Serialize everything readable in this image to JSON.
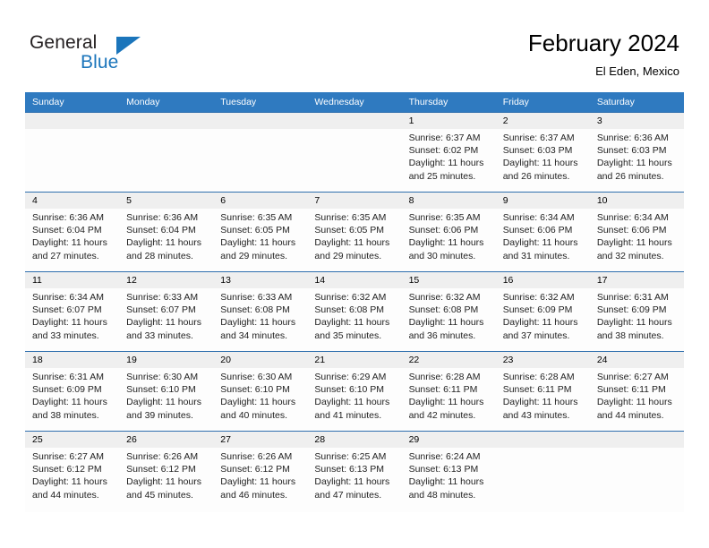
{
  "brand": {
    "name_part1": "General",
    "name_part2": "Blue",
    "logo_icon": "triangle-flag-icon",
    "accent_color": "#1b75bb"
  },
  "header": {
    "title": "February 2024",
    "subtitle": "El Eden, Mexico"
  },
  "colors": {
    "header_row_bg": "#2f7ac0",
    "date_band_bg": "#efefef",
    "row_divider": "#2f6fae"
  },
  "weekday_headers": [
    "Sunday",
    "Monday",
    "Tuesday",
    "Wednesday",
    "Thursday",
    "Friday",
    "Saturday"
  ],
  "weeks": [
    [
      {
        "day": "",
        "sunrise": "",
        "sunset": "",
        "daylight_line1": "",
        "daylight_line2": ""
      },
      {
        "day": "",
        "sunrise": "",
        "sunset": "",
        "daylight_line1": "",
        "daylight_line2": ""
      },
      {
        "day": "",
        "sunrise": "",
        "sunset": "",
        "daylight_line1": "",
        "daylight_line2": ""
      },
      {
        "day": "",
        "sunrise": "",
        "sunset": "",
        "daylight_line1": "",
        "daylight_line2": ""
      },
      {
        "day": "1",
        "sunrise": "Sunrise: 6:37 AM",
        "sunset": "Sunset: 6:02 PM",
        "daylight_line1": "Daylight: 11 hours",
        "daylight_line2": "and 25 minutes."
      },
      {
        "day": "2",
        "sunrise": "Sunrise: 6:37 AM",
        "sunset": "Sunset: 6:03 PM",
        "daylight_line1": "Daylight: 11 hours",
        "daylight_line2": "and 26 minutes."
      },
      {
        "day": "3",
        "sunrise": "Sunrise: 6:36 AM",
        "sunset": "Sunset: 6:03 PM",
        "daylight_line1": "Daylight: 11 hours",
        "daylight_line2": "and 26 minutes."
      }
    ],
    [
      {
        "day": "4",
        "sunrise": "Sunrise: 6:36 AM",
        "sunset": "Sunset: 6:04 PM",
        "daylight_line1": "Daylight: 11 hours",
        "daylight_line2": "and 27 minutes."
      },
      {
        "day": "5",
        "sunrise": "Sunrise: 6:36 AM",
        "sunset": "Sunset: 6:04 PM",
        "daylight_line1": "Daylight: 11 hours",
        "daylight_line2": "and 28 minutes."
      },
      {
        "day": "6",
        "sunrise": "Sunrise: 6:35 AM",
        "sunset": "Sunset: 6:05 PM",
        "daylight_line1": "Daylight: 11 hours",
        "daylight_line2": "and 29 minutes."
      },
      {
        "day": "7",
        "sunrise": "Sunrise: 6:35 AM",
        "sunset": "Sunset: 6:05 PM",
        "daylight_line1": "Daylight: 11 hours",
        "daylight_line2": "and 29 minutes."
      },
      {
        "day": "8",
        "sunrise": "Sunrise: 6:35 AM",
        "sunset": "Sunset: 6:06 PM",
        "daylight_line1": "Daylight: 11 hours",
        "daylight_line2": "and 30 minutes."
      },
      {
        "day": "9",
        "sunrise": "Sunrise: 6:34 AM",
        "sunset": "Sunset: 6:06 PM",
        "daylight_line1": "Daylight: 11 hours",
        "daylight_line2": "and 31 minutes."
      },
      {
        "day": "10",
        "sunrise": "Sunrise: 6:34 AM",
        "sunset": "Sunset: 6:06 PM",
        "daylight_line1": "Daylight: 11 hours",
        "daylight_line2": "and 32 minutes."
      }
    ],
    [
      {
        "day": "11",
        "sunrise": "Sunrise: 6:34 AM",
        "sunset": "Sunset: 6:07 PM",
        "daylight_line1": "Daylight: 11 hours",
        "daylight_line2": "and 33 minutes."
      },
      {
        "day": "12",
        "sunrise": "Sunrise: 6:33 AM",
        "sunset": "Sunset: 6:07 PM",
        "daylight_line1": "Daylight: 11 hours",
        "daylight_line2": "and 33 minutes."
      },
      {
        "day": "13",
        "sunrise": "Sunrise: 6:33 AM",
        "sunset": "Sunset: 6:08 PM",
        "daylight_line1": "Daylight: 11 hours",
        "daylight_line2": "and 34 minutes."
      },
      {
        "day": "14",
        "sunrise": "Sunrise: 6:32 AM",
        "sunset": "Sunset: 6:08 PM",
        "daylight_line1": "Daylight: 11 hours",
        "daylight_line2": "and 35 minutes."
      },
      {
        "day": "15",
        "sunrise": "Sunrise: 6:32 AM",
        "sunset": "Sunset: 6:08 PM",
        "daylight_line1": "Daylight: 11 hours",
        "daylight_line2": "and 36 minutes."
      },
      {
        "day": "16",
        "sunrise": "Sunrise: 6:32 AM",
        "sunset": "Sunset: 6:09 PM",
        "daylight_line1": "Daylight: 11 hours",
        "daylight_line2": "and 37 minutes."
      },
      {
        "day": "17",
        "sunrise": "Sunrise: 6:31 AM",
        "sunset": "Sunset: 6:09 PM",
        "daylight_line1": "Daylight: 11 hours",
        "daylight_line2": "and 38 minutes."
      }
    ],
    [
      {
        "day": "18",
        "sunrise": "Sunrise: 6:31 AM",
        "sunset": "Sunset: 6:09 PM",
        "daylight_line1": "Daylight: 11 hours",
        "daylight_line2": "and 38 minutes."
      },
      {
        "day": "19",
        "sunrise": "Sunrise: 6:30 AM",
        "sunset": "Sunset: 6:10 PM",
        "daylight_line1": "Daylight: 11 hours",
        "daylight_line2": "and 39 minutes."
      },
      {
        "day": "20",
        "sunrise": "Sunrise: 6:30 AM",
        "sunset": "Sunset: 6:10 PM",
        "daylight_line1": "Daylight: 11 hours",
        "daylight_line2": "and 40 minutes."
      },
      {
        "day": "21",
        "sunrise": "Sunrise: 6:29 AM",
        "sunset": "Sunset: 6:10 PM",
        "daylight_line1": "Daylight: 11 hours",
        "daylight_line2": "and 41 minutes."
      },
      {
        "day": "22",
        "sunrise": "Sunrise: 6:28 AM",
        "sunset": "Sunset: 6:11 PM",
        "daylight_line1": "Daylight: 11 hours",
        "daylight_line2": "and 42 minutes."
      },
      {
        "day": "23",
        "sunrise": "Sunrise: 6:28 AM",
        "sunset": "Sunset: 6:11 PM",
        "daylight_line1": "Daylight: 11 hours",
        "daylight_line2": "and 43 minutes."
      },
      {
        "day": "24",
        "sunrise": "Sunrise: 6:27 AM",
        "sunset": "Sunset: 6:11 PM",
        "daylight_line1": "Daylight: 11 hours",
        "daylight_line2": "and 44 minutes."
      }
    ],
    [
      {
        "day": "25",
        "sunrise": "Sunrise: 6:27 AM",
        "sunset": "Sunset: 6:12 PM",
        "daylight_line1": "Daylight: 11 hours",
        "daylight_line2": "and 44 minutes."
      },
      {
        "day": "26",
        "sunrise": "Sunrise: 6:26 AM",
        "sunset": "Sunset: 6:12 PM",
        "daylight_line1": "Daylight: 11 hours",
        "daylight_line2": "and 45 minutes."
      },
      {
        "day": "27",
        "sunrise": "Sunrise: 6:26 AM",
        "sunset": "Sunset: 6:12 PM",
        "daylight_line1": "Daylight: 11 hours",
        "daylight_line2": "and 46 minutes."
      },
      {
        "day": "28",
        "sunrise": "Sunrise: 6:25 AM",
        "sunset": "Sunset: 6:13 PM",
        "daylight_line1": "Daylight: 11 hours",
        "daylight_line2": "and 47 minutes."
      },
      {
        "day": "29",
        "sunrise": "Sunrise: 6:24 AM",
        "sunset": "Sunset: 6:13 PM",
        "daylight_line1": "Daylight: 11 hours",
        "daylight_line2": "and 48 minutes."
      },
      {
        "day": "",
        "sunrise": "",
        "sunset": "",
        "daylight_line1": "",
        "daylight_line2": ""
      },
      {
        "day": "",
        "sunrise": "",
        "sunset": "",
        "daylight_line1": "",
        "daylight_line2": ""
      }
    ]
  ]
}
